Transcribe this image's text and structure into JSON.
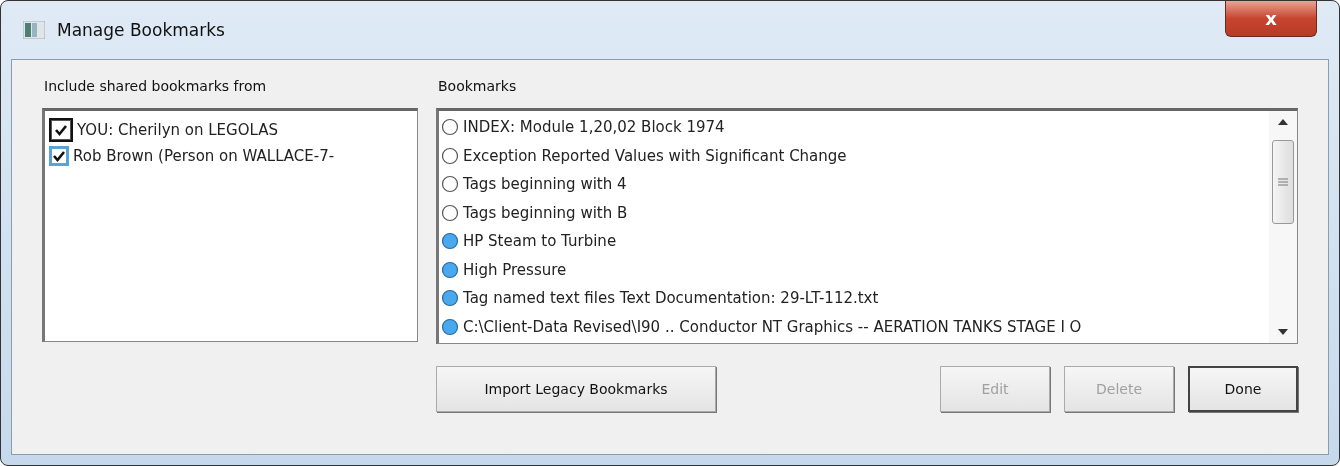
{
  "window": {
    "title": "Manage Bookmarks",
    "close_label": "x"
  },
  "shared_from": {
    "label": "Include shared bookmarks from",
    "items": [
      {
        "label": "YOU: Cherilyn on LEGOLAS",
        "checked": true,
        "focused": true
      },
      {
        "label": "Rob Brown (Person on WALLACE-7-",
        "checked": true,
        "focused": false
      }
    ]
  },
  "bookmarks": {
    "label": "Bookmarks",
    "items": [
      {
        "label": "INDEX: Module 1,20,02 Block 1974",
        "filled": false
      },
      {
        "label": "Exception Reported Values with Significant Change",
        "filled": false
      },
      {
        "label": "Tags beginning with 4",
        "filled": false
      },
      {
        "label": "Tags beginning with B",
        "filled": false
      },
      {
        "label": "HP Steam to Turbine",
        "filled": true
      },
      {
        "label": "High Pressure",
        "filled": true
      },
      {
        "label": "Tag named text files Text Documentation: 29-LT-112.txt",
        "filled": true
      },
      {
        "label": "C:\\Client-Data Revised\\I90 .. Conductor NT Graphics -- AERATION TANKS STAGE I O",
        "filled": true
      }
    ]
  },
  "buttons": [
    {
      "label": "Import Legacy Bookmarks",
      "disabled": false,
      "default": false
    },
    {
      "label": "Edit",
      "disabled": true,
      "default": false
    },
    {
      "label": "Delete",
      "disabled": true,
      "default": false
    },
    {
      "label": "Done",
      "disabled": false,
      "default": true
    }
  ]
}
